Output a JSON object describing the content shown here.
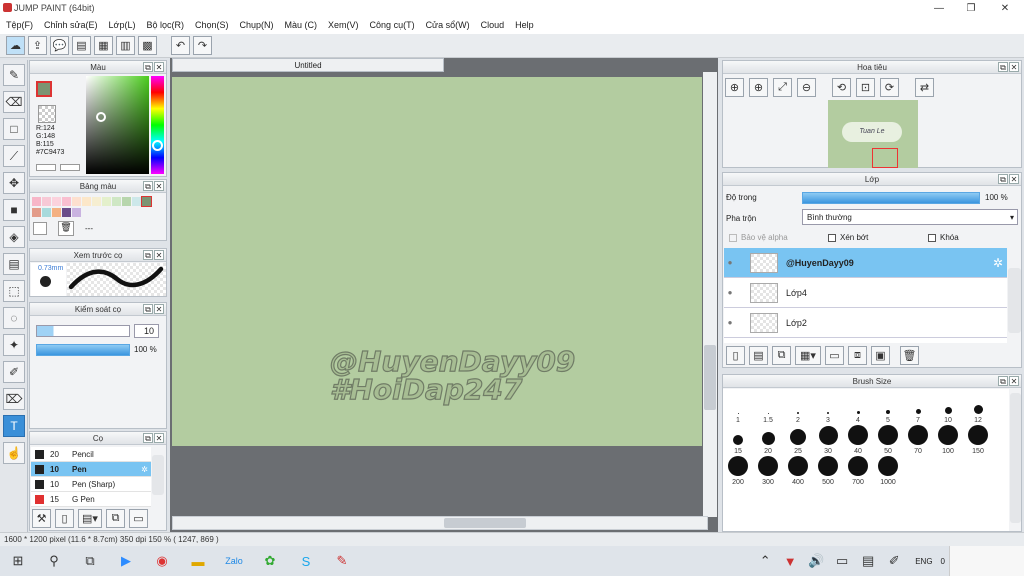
{
  "window": {
    "title": "JUMP PAINT (64bit)",
    "minimize": "—",
    "maximize": "❐",
    "close": "✕"
  },
  "menu": [
    "Tệp(F)",
    "Chỉnh sửa(E)",
    "Lớp(L)",
    "Bộ lọc(R)",
    "Chọn(S)",
    "Chụp(N)",
    "Màu (C)",
    "Xem(V)",
    "Công cụ(T)",
    "Cửa sổ(W)",
    "Cloud",
    "Help"
  ],
  "color_panel": {
    "title": "Màu",
    "r": "R:124",
    "g": "G:148",
    "b": "B:115",
    "hex": "#7C9473",
    "fg_color": "#7c9473"
  },
  "swatch_panel": {
    "title": "Bảng màu",
    "dash": "---"
  },
  "brush_preview": {
    "title": "Xem trước cọ",
    "size": "0.73mm"
  },
  "brush_control": {
    "title": "Kiểm soát cọ",
    "size": "10",
    "opacity": "100 %"
  },
  "brush_list": {
    "title": "Cọ",
    "items": [
      {
        "size": "20",
        "name": "Pencil",
        "color": "#222222",
        "selected": false
      },
      {
        "size": "10",
        "name": "Pen",
        "color": "#222222",
        "selected": true
      },
      {
        "size": "10",
        "name": "Pen (Sharp)",
        "color": "#222222",
        "selected": false
      },
      {
        "size": "15",
        "name": "G Pen",
        "color": "#e03030",
        "selected": false
      }
    ]
  },
  "document": {
    "tab": "Untitled",
    "watermark_line1": "@HuyenDayy09",
    "watermark_line2": "#HoiDap247",
    "canvas_color": "#b3cca0"
  },
  "navigator": {
    "title": "Hoa tiêu",
    "thumb_text": "Tuan Le"
  },
  "layer_panel": {
    "title": "Lớp",
    "opacity_label": "Độ trong",
    "opacity_value": "100 %",
    "blend_label": "Pha trộn",
    "blend_value": "Bình thường",
    "protect_alpha": "Bảo vệ alpha",
    "clipping": "Xén bớt",
    "lock": "Khóa",
    "layers": [
      {
        "name": "@HuyenDayy09",
        "selected": true
      },
      {
        "name": "Lớp4",
        "selected": false
      },
      {
        "name": "Lớp2",
        "selected": false
      }
    ]
  },
  "brush_size": {
    "title": "Brush Size",
    "sizes": [
      "1",
      "1.5",
      "2",
      "3",
      "4",
      "5",
      "7",
      "10",
      "12",
      "15",
      "20",
      "25",
      "30",
      "40",
      "50",
      "70",
      "100",
      "150",
      "200",
      "300",
      "400",
      "500",
      "700",
      "1000"
    ]
  },
  "status": {
    "text": "1600 * 1200 pixel  (11.6 * 8.7cm)  350 dpi  150 %  ( 1247, 869 )"
  },
  "taskbar": {
    "lang": "ENG",
    "trail": "0"
  }
}
